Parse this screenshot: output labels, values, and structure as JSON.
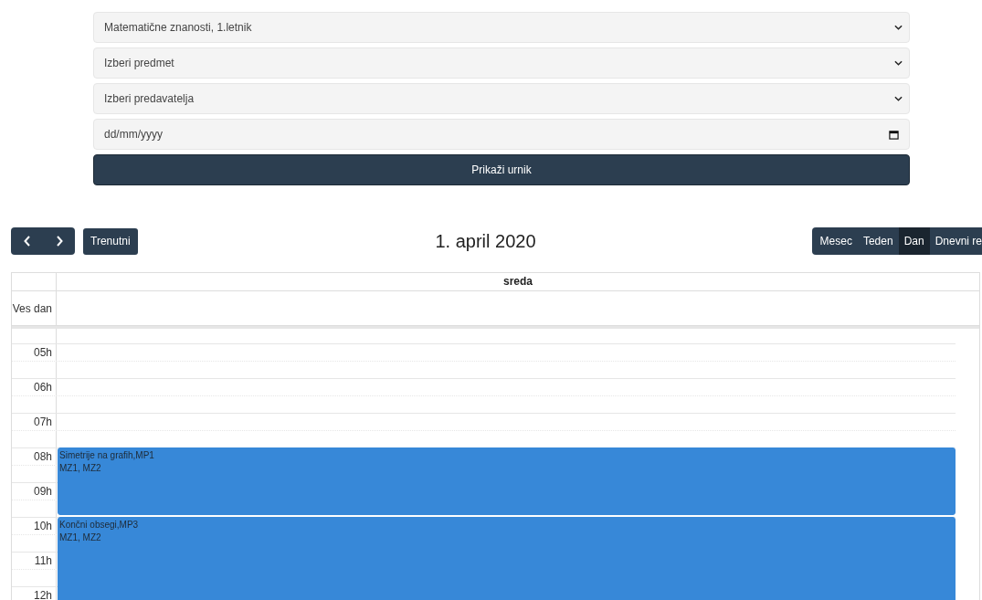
{
  "form": {
    "fields": [
      {
        "kind": "select",
        "value": "Matematične znanosti, 1.letnik"
      },
      {
        "kind": "select",
        "value": "Izberi predmet"
      },
      {
        "kind": "select",
        "value": "Izberi predavatelja"
      },
      {
        "kind": "date",
        "placeholder": "dd/mm/yyyy"
      }
    ],
    "submit": "Prikaži urnik"
  },
  "toolbar": {
    "today": "Trenutni",
    "title": "1. april 2020",
    "views": [
      {
        "label": "Mesec",
        "selected": false
      },
      {
        "label": "Teden",
        "selected": false
      },
      {
        "label": "Dan",
        "selected": true
      },
      {
        "label": "Dnevni re",
        "selected": false
      }
    ]
  },
  "calendar": {
    "day": "sreda",
    "all_day": "Ves dan",
    "hours": [
      {
        "label": "05h"
      },
      {
        "label": "06h"
      },
      {
        "label": "07h"
      },
      {
        "label": "08h",
        "events": [
          {
            "title": "Simetrije na grafih,MP1",
            "groups": "MZ1, MZ2"
          }
        ]
      },
      {
        "label": "09h"
      },
      {
        "label": "10h",
        "events": [
          {
            "title": "Končni obsegi,MP3",
            "groups": "MZ1, MZ2"
          }
        ]
      },
      {
        "label": "11h"
      },
      {
        "label": "12h"
      }
    ]
  }
}
